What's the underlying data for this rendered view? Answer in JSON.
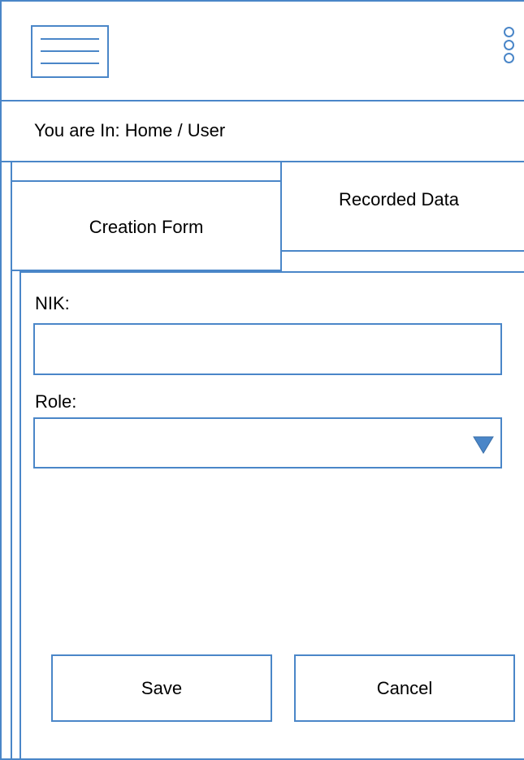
{
  "header": {
    "menu_icon": "hamburger-menu-icon",
    "more_icon": "more-vertical-icon"
  },
  "breadcrumb": {
    "text": "You are In: Home / User"
  },
  "tabs": [
    {
      "label": "Creation Form",
      "active": true
    },
    {
      "label": "Recorded Data",
      "active": false
    }
  ],
  "form": {
    "nik_label": "NIK:",
    "nik_value": "",
    "role_label": "Role:",
    "role_value": "",
    "dropdown_icon": "triangle-down-icon"
  },
  "actions": {
    "save_label": "Save",
    "cancel_label": "Cancel"
  },
  "colors": {
    "accent": "#4a86c8",
    "background": "#ffffff"
  }
}
